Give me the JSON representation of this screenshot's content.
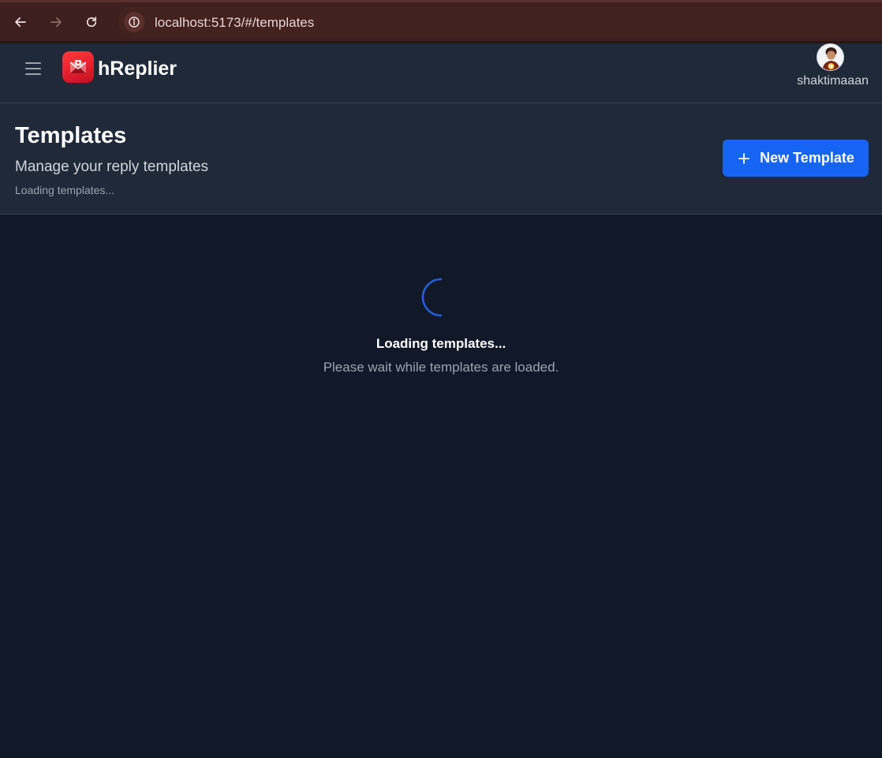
{
  "browser": {
    "url": "localhost:5173/#/templates",
    "icons": [
      "back-arrow-icon",
      "forward-arrow-icon",
      "reload-icon",
      "site-info-icon"
    ]
  },
  "header": {
    "brand": "hReplier",
    "username": "shaktimaaan",
    "logo_color": "#e11d2e"
  },
  "page": {
    "title": "Templates",
    "subtitle": "Manage your reply templates",
    "status": "Loading templates...",
    "new_button_label": "New Template"
  },
  "loading": {
    "title": "Loading templates...",
    "message": "Please wait while templates are loaded."
  },
  "colors": {
    "accent": "#1664f4",
    "background": "#111827",
    "panel": "#1f2937"
  }
}
